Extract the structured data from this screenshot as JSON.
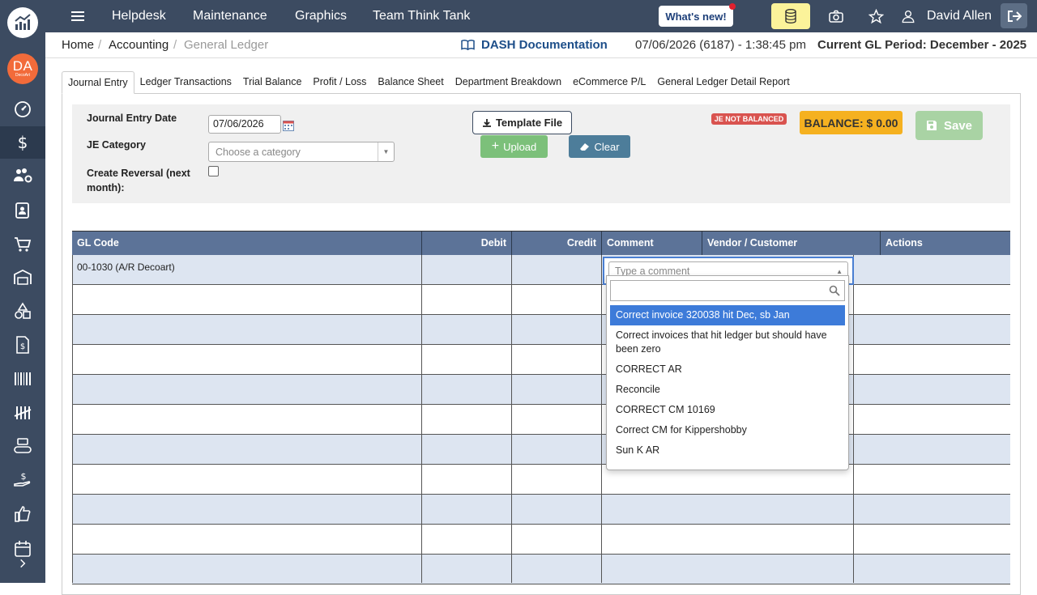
{
  "topbar": {
    "nav": [
      "Helpdesk",
      "Maintenance",
      "Graphics",
      "Team Think Tank"
    ],
    "whats_new": "What's new!",
    "user_name": "David Allen"
  },
  "avatar": {
    "initials": "DA",
    "sub": "DecoArt"
  },
  "sidebar": {
    "items": [
      "dashboard-gauge",
      "dollar",
      "users-gear",
      "contact-card",
      "cart",
      "warehouse",
      "shapes",
      "invoice",
      "barcode",
      "tally",
      "conveyor",
      "hand-money",
      "thumbs-up",
      "calendar"
    ]
  },
  "breadcrumb": {
    "home": "Home",
    "section": "Accounting",
    "current": "General Ledger"
  },
  "docs_label": "DASH Documentation",
  "datetime": "07/06/2026 (6187) - 1:38:45 pm",
  "gl_period": "Current GL Period: December - 2025",
  "tabs": [
    "Journal Entry",
    "Ledger Transactions",
    "Trial Balance",
    "Profit / Loss",
    "Balance Sheet",
    "Department Breakdown",
    "eCommerce P/L",
    "General Ledger Detail Report"
  ],
  "form": {
    "je_date_label": "Journal Entry Date",
    "je_date_value": "07/06/2026",
    "category_label": "JE Category",
    "category_placeholder": "Choose a category",
    "reversal_label_1": "Create Reversal (next",
    "reversal_label_2": "month):",
    "template_btn": "Template File",
    "upload_btn": "Upload",
    "clear_btn": "Clear",
    "not_balanced": "JE NOT BALANCED",
    "balance": "BALANCE: $ 0.00",
    "save_btn": "Save"
  },
  "grid": {
    "headers": [
      "GL Code",
      "Debit",
      "Credit",
      "Comment",
      "Vendor / Customer",
      "Actions"
    ],
    "first_row_gl": "00-1030 (A/R Decoart)"
  },
  "comment_combo": {
    "placeholder": "Type a comment",
    "options": [
      "Correct invoice 320038 hit Dec, sb Jan",
      "Correct invoices that hit ledger but should have been zero",
      "CORRECT AR",
      "Reconcile",
      "CORRECT CM 10169",
      "Correct CM for Kippershobby",
      "Sun K AR"
    ]
  },
  "colors": {
    "sidebar": "#3c4b61",
    "grid_header": "#5c7398",
    "alt_row": "#dde5f1",
    "balance": "#f5b120",
    "highlight": "#3d7bd9"
  }
}
